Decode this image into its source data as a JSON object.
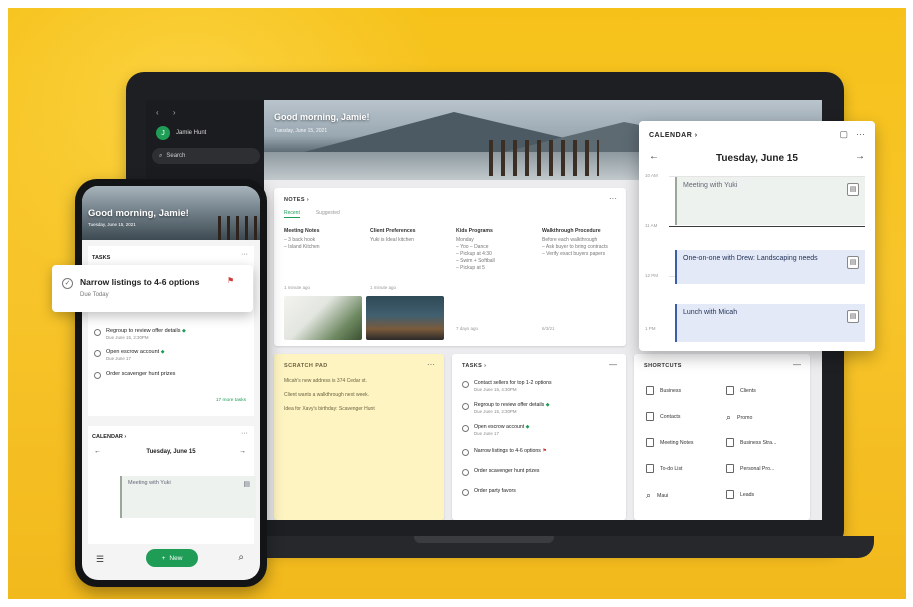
{
  "colors": {
    "background": "#f6c21a",
    "accent": "#1f9d57",
    "event": "#3a5fa8",
    "scratch": "#fdf4c2",
    "flag_red": "#d13b3b"
  },
  "desktop": {
    "sidebar": {
      "nav_arrows": "‹ ›",
      "user_name": "Jamie Hunt",
      "avatar_initial": "J",
      "search_label": "Search"
    },
    "hero": {
      "greeting": "Good morning, Jamie!",
      "date": "Tuesday, June 15, 2021"
    },
    "notes": {
      "title": "NOTES",
      "chevron": "›",
      "more": "···",
      "tabs": [
        "Recent",
        "Suggested"
      ],
      "items": [
        {
          "title": "Meeting Notes",
          "body": "– 3 back hook\n– Island Kitchen",
          "meta": "1 minute ago"
        },
        {
          "title": "Client Preferences",
          "body": "Yuki is Ideal kitchen",
          "meta": "1 minute ago"
        },
        {
          "title": "Kids Programs",
          "body": "Monday\n– Yoo – Dance\n– Pickup at 4:30\n– Swim + Softball\n– Pickup at 5",
          "meta": "7 days ago"
        },
        {
          "title": "Walkthrough Procedure",
          "body": "Before each walkthrough\n– Ask buyer to bring contracts\n– Verify exact buyers papers",
          "meta": "6/3/21"
        }
      ]
    },
    "scratch": {
      "title": "SCRATCH PAD",
      "more": "···",
      "lines": [
        "Micah's new address is 374 Cedar st.",
        "Client wants a walkthrough next week.",
        "Idea for Xavy's birthday: Scavenger Hunt"
      ]
    },
    "tasks": {
      "title": "TASKS",
      "chevron": "›",
      "more": "—",
      "items": [
        {
          "title": "Contact sellers for top 1-2 options",
          "due": "Due June 15, 4:30PM",
          "flag": ""
        },
        {
          "title": "Regroup to review offer details",
          "due": "Due June 15, 2:30PM",
          "flag": "◆"
        },
        {
          "title": "Open escrow account",
          "due": "Due June 17",
          "flag": "◆"
        },
        {
          "title": "Narrow listings to 4-6 options",
          "due": "",
          "flag": "⚑"
        },
        {
          "title": "Order scavenger hunt prizes",
          "due": "",
          "flag": ""
        },
        {
          "title": "Order party favors",
          "due": "",
          "flag": ""
        }
      ]
    },
    "shortcuts": {
      "title": "SHORTCUTS",
      "more": "—",
      "items": [
        {
          "label": "Business",
          "icon": "notebook-icon"
        },
        {
          "label": "Clients",
          "icon": "notebook-icon"
        },
        {
          "label": "Contacts",
          "icon": "note-icon"
        },
        {
          "label": "Promo",
          "icon": "search-icon"
        },
        {
          "label": "Meeting Notes",
          "icon": "notebook-icon"
        },
        {
          "label": "Business Stra...",
          "icon": "notebook-icon"
        },
        {
          "label": "To-do List",
          "icon": "note-icon"
        },
        {
          "label": "Personal Pro...",
          "icon": "notebook-icon"
        },
        {
          "label": "Maui",
          "icon": "search-icon"
        },
        {
          "label": "Leads",
          "icon": "tag-icon"
        }
      ]
    }
  },
  "calendar": {
    "title": "CALENDAR",
    "chevron": "›",
    "prev": "←",
    "next": "→",
    "date": "Tuesday, June 15",
    "times": [
      "10 AM",
      "11 AM",
      "12 PM",
      "1 PM"
    ],
    "events": [
      {
        "title": "Meeting with Yuki"
      },
      {
        "title": "One-on-one with Drew: Landscaping needs"
      },
      {
        "title": "Lunch with Micah"
      }
    ]
  },
  "phone": {
    "greeting": "Good morning, Jamie!",
    "date": "Tuesday, June 15, 2021",
    "tasks_title": "TASKS",
    "tasks_more": "···",
    "tasks": [
      {
        "title": "Regroup to review offer details",
        "due": "Due June 15, 2:30PM"
      },
      {
        "title": "Open escrow account",
        "due": "Due June 17"
      },
      {
        "title": "Order scavenger hunt prizes",
        "due": ""
      }
    ],
    "more_tasks": "17 more tasks",
    "calendar_title": "CALENDAR",
    "calendar_date": "Tuesday, June 15",
    "calendar_event": "Meeting with Yuki",
    "new_button": "New",
    "new_plus": "+"
  },
  "task_pill": {
    "title": "Narrow listings to 4-6 options",
    "due": "Due Today",
    "check": "✓",
    "flag": "⚑"
  }
}
